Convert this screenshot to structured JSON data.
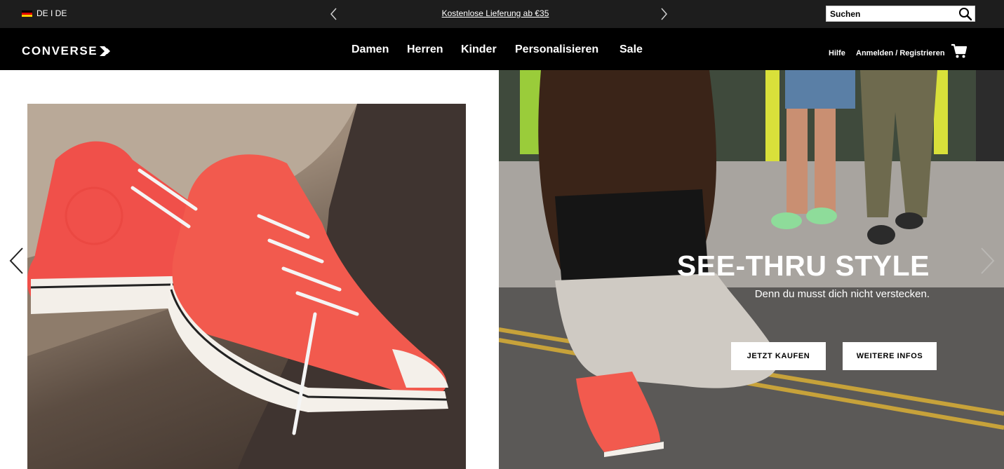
{
  "topbar": {
    "locale": "DE I DE",
    "promo_text": "Kostenlose Lieferung ab €35",
    "search_placeholder": "Suchen"
  },
  "brand": {
    "name": "CONVERSE"
  },
  "nav": {
    "items": [
      "Damen",
      "Herren",
      "Kinder",
      "Personalisieren",
      "Sale"
    ],
    "help": "Hilfe",
    "login": "Anmelden / Registrieren"
  },
  "hero": {
    "headline": "SEE-THRU STYLE",
    "subline": "Denn du musst dich nicht verstecken.",
    "cta_buy": "JETZT KAUFEN",
    "cta_info": "WEITERE INFOS"
  },
  "colors": {
    "topbar_bg": "#1d1d1d",
    "nav_bg": "#000000",
    "shoe_red": "#f0504a"
  },
  "icons": {
    "search": "search-icon",
    "cart": "cart-icon",
    "prev": "chevron-left-icon",
    "next": "chevron-right-icon",
    "flag": "germany-flag-icon",
    "logo_arrow": "converse-arrow-icon"
  }
}
